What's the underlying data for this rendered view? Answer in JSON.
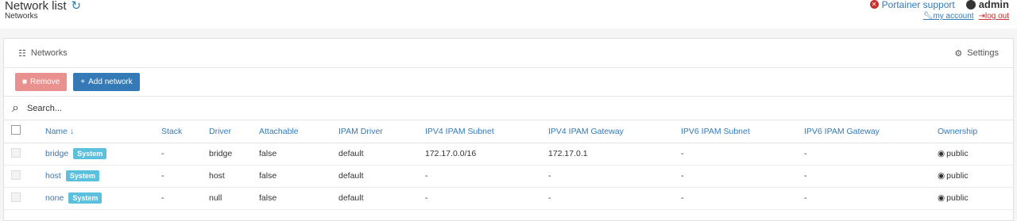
{
  "header": {
    "title": "Network list",
    "breadcrumb": "Networks",
    "support_label": "Portainer support",
    "username": "admin",
    "my_account": "my account",
    "log_out": "log out"
  },
  "panel": {
    "title": "Networks",
    "settings_label": "Settings",
    "remove_label": "Remove",
    "add_label": "Add network",
    "search_placeholder": "Search..."
  },
  "table": {
    "columns": [
      "Name",
      "Stack",
      "Driver",
      "Attachable",
      "IPAM Driver",
      "IPV4 IPAM Subnet",
      "IPV4 IPAM Gateway",
      "IPV6 IPAM Subnet",
      "IPV6 IPAM Gateway",
      "Ownership"
    ],
    "rows": [
      {
        "name": "bridge",
        "badge": "System",
        "stack": "-",
        "driver": "bridge",
        "attachable": "false",
        "ipam_driver": "default",
        "ipv4_subnet": "172.17.0.0/16",
        "ipv4_gateway": "172.17.0.1",
        "ipv6_subnet": "-",
        "ipv6_gateway": "-",
        "ownership": "public"
      },
      {
        "name": "host",
        "badge": "System",
        "stack": "-",
        "driver": "host",
        "attachable": "false",
        "ipam_driver": "default",
        "ipv4_subnet": "-",
        "ipv4_gateway": "-",
        "ipv6_subnet": "-",
        "ipv6_gateway": "-",
        "ownership": "public"
      },
      {
        "name": "none",
        "badge": "System",
        "stack": "-",
        "driver": "null",
        "attachable": "false",
        "ipam_driver": "default",
        "ipv4_subnet": "-",
        "ipv4_gateway": "-",
        "ipv6_subnet": "-",
        "ipv6_gateway": "-",
        "ownership": "public"
      }
    ]
  },
  "icons": {
    "refresh": "refresh-icon",
    "support": "times-circle-icon",
    "user": "user-circle-icon",
    "wrench": "wrench-icon",
    "logout": "sign-out-icon",
    "sitemap": "sitemap-icon",
    "settings": "gear-icon",
    "trash": "trash-icon",
    "plus": "plus-icon",
    "search": "search-icon",
    "sort": "sort-alpha-icon",
    "eye": "eye-icon"
  },
  "colors": {
    "link": "#337ab7",
    "remove_button": "#e8918f",
    "add_button": "#337ab7",
    "badge": "#5bc0de",
    "danger": "#c9302c"
  }
}
